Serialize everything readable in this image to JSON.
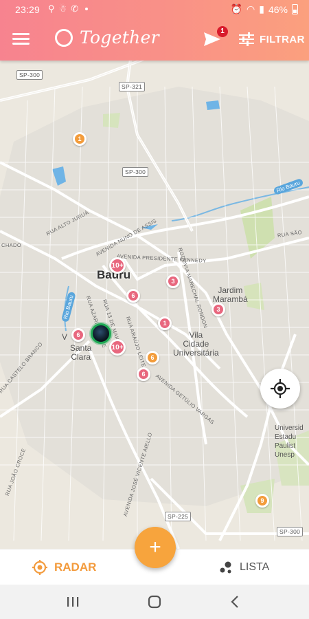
{
  "status_bar": {
    "time": "23:29",
    "battery": "46%"
  },
  "app_bar": {
    "title": "Together",
    "notification_count": "1",
    "filter_label": "FILTRAR"
  },
  "map": {
    "road_labels": [
      "SP-300",
      "SP-321",
      "SP-300",
      "SP-225",
      "SP-300"
    ],
    "street_labels": [
      "RUA ALTO JURUÁ",
      "AVENIDA NUNO DE ASSIS",
      "AVENIDA PRESIDENTE KENNEDY",
      "RUA SÃO",
      "CHADO",
      "RODOVIA MARECHAL RONDON",
      "RUA CASTELO BRANCO",
      "RUA JOÃO CROCE",
      "AVENIDA JOSÉ VICENTE AIELLO",
      "AVENIDA GETÚLIO VARGAS",
      "RUA ARAÚJO LEITE",
      "RUA 13 DE MAIO",
      "RUA AZARIAS LEITE"
    ],
    "city_label": "Bauru",
    "place_labels": {
      "jardim_marambá": "Jardim\nMarambá",
      "vila_cidade": "Vila\nCidade\nUniversitária",
      "santa_clara": "Santa\nClara",
      "v": "V",
      "universidade": "Universid\nEstadu\nPaulist\nUnesp"
    },
    "water_label": "Rio Bauru",
    "markers": [
      {
        "label": "1",
        "color": "orange"
      },
      {
        "label": "10+",
        "color": "pink"
      },
      {
        "label": "3",
        "color": "pink"
      },
      {
        "label": "6",
        "color": "pink"
      },
      {
        "label": "3",
        "color": "pink"
      },
      {
        "label": "1",
        "color": "pink"
      },
      {
        "label": "6",
        "color": "pink"
      },
      {
        "label": "10+",
        "color": "pink"
      },
      {
        "label": "6",
        "color": "orange"
      },
      {
        "label": "6",
        "color": "pink"
      },
      {
        "label": "9",
        "color": "orange"
      }
    ]
  },
  "bottom_tabs": {
    "radar_label": "RADAR",
    "lista_label": "LISTA",
    "fab_label": "+"
  },
  "colors": {
    "header_start": "#f7838f",
    "header_end": "#fba07e",
    "accent_orange": "#f39b3d",
    "marker_pink": "#e8677e"
  }
}
